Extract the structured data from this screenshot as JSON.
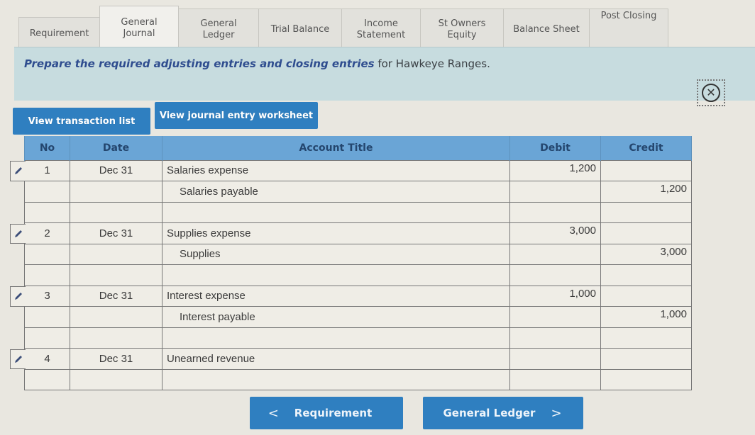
{
  "tabs": [
    {
      "label": "Requirement",
      "active": false
    },
    {
      "label": "General\nJournal",
      "active": true
    },
    {
      "label": "General\nLedger",
      "active": false
    },
    {
      "label": "Trial Balance",
      "active": false
    },
    {
      "label": "Income\nStatement",
      "active": false
    },
    {
      "label": "St Owners\nEquity",
      "active": false
    },
    {
      "label": "Balance Sheet",
      "active": false
    },
    {
      "label": "Post Closing",
      "active": false
    }
  ],
  "banner": {
    "prefix": "Prepare the required adjusting entries and closing entries",
    "suffix": " for Hawkeye Ranges."
  },
  "close_icon": "close-circle-icon",
  "buttons": {
    "view_transaction_list": "View transaction list",
    "view_journal_entry_worksheet": "View journal entry worksheet"
  },
  "table": {
    "headers": {
      "no": "No",
      "date": "Date",
      "account_title": "Account Title",
      "debit": "Debit",
      "credit": "Credit"
    },
    "rows": [
      {
        "no": "1",
        "date": "Dec 31",
        "account": "Salaries expense",
        "indent": false,
        "debit": "1,200",
        "credit": "",
        "editable": true
      },
      {
        "no": "",
        "date": "",
        "account": "Salaries payable",
        "indent": true,
        "debit": "",
        "credit": "1,200",
        "editable": false
      },
      {
        "no": "",
        "date": "",
        "account": "",
        "indent": false,
        "debit": "",
        "credit": "",
        "editable": false
      },
      {
        "no": "2",
        "date": "Dec 31",
        "account": "Supplies expense",
        "indent": false,
        "debit": "3,000",
        "credit": "",
        "editable": true
      },
      {
        "no": "",
        "date": "",
        "account": "Supplies",
        "indent": true,
        "debit": "",
        "credit": "3,000",
        "editable": false
      },
      {
        "no": "",
        "date": "",
        "account": "",
        "indent": false,
        "debit": "",
        "credit": "",
        "editable": false
      },
      {
        "no": "3",
        "date": "Dec 31",
        "account": "Interest expense",
        "indent": false,
        "debit": "1,000",
        "credit": "",
        "editable": true
      },
      {
        "no": "",
        "date": "",
        "account": "Interest payable",
        "indent": true,
        "debit": "",
        "credit": "1,000",
        "editable": false
      },
      {
        "no": "",
        "date": "",
        "account": "",
        "indent": false,
        "debit": "",
        "credit": "",
        "editable": false
      },
      {
        "no": "4",
        "date": "Dec 31",
        "account": "Unearned revenue",
        "indent": false,
        "debit": "",
        "credit": "",
        "editable": true
      },
      {
        "no": "",
        "date": "",
        "account": "",
        "indent": false,
        "debit": "",
        "credit": "",
        "editable": false
      }
    ]
  },
  "nav": {
    "prev_label": "Requirement",
    "next_label": "General Ledger"
  },
  "colors": {
    "accent": "#2f7fc0",
    "table_header": "#6aa5d6",
    "banner_bg": "#c7dcdf",
    "banner_emphasis": "#2f4d8f"
  }
}
